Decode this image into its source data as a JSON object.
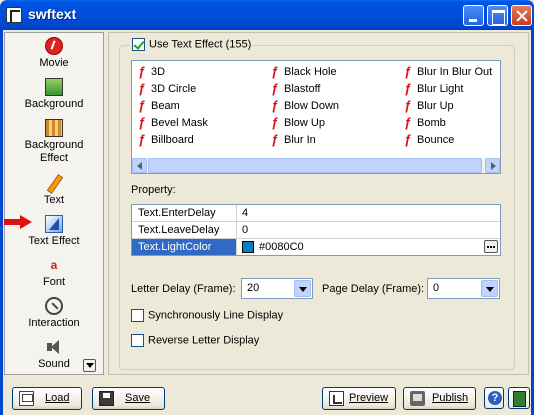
{
  "window": {
    "title": "swftext"
  },
  "sidebar": {
    "items": [
      {
        "label": "Movie",
        "icon": "movie-icon"
      },
      {
        "label": "Background",
        "icon": "background-icon"
      },
      {
        "label": "Background Effect",
        "icon": "background-effect-icon"
      },
      {
        "label": "Text",
        "icon": "text-pencil-icon"
      },
      {
        "label": "Text Effect",
        "icon": "text-effect-icon"
      },
      {
        "label": "Font",
        "icon": "font-icon"
      },
      {
        "label": "Interaction",
        "icon": "interaction-icon"
      },
      {
        "label": "Sound",
        "icon": "sound-icon"
      }
    ],
    "selected": "Text Effect"
  },
  "main": {
    "use_text_effect_label": "Use Text Effect (155)",
    "use_text_effect_checked": true,
    "effects": [
      {
        "name": "3D"
      },
      {
        "name": "Black Hole"
      },
      {
        "name": "Blur In Blur Out"
      },
      {
        "name": "3D Circle"
      },
      {
        "name": "Blastoff"
      },
      {
        "name": "Blur Light"
      },
      {
        "name": "Beam",
        "selected": true
      },
      {
        "name": "Blow Down"
      },
      {
        "name": "Blur Up"
      },
      {
        "name": "Bevel Mask"
      },
      {
        "name": "Blow Up"
      },
      {
        "name": "Bomb"
      },
      {
        "name": "Billboard"
      },
      {
        "name": "Blur In"
      },
      {
        "name": "Bounce"
      }
    ],
    "property_label": "Property:",
    "properties": [
      {
        "name": "Text.EnterDelay",
        "value": "4"
      },
      {
        "name": "Text.LeaveDelay",
        "value": "0"
      },
      {
        "name": "Text.LightColor",
        "value": "#0080C0",
        "swatch": "#0080C0",
        "selected": true
      }
    ],
    "letter_delay": {
      "label": "Letter Delay (Frame):",
      "value": "20"
    },
    "page_delay": {
      "label": "Page Delay (Frame):",
      "value": "0"
    },
    "sync_line_display": {
      "label": "Synchronously Line Display",
      "checked": false
    },
    "reverse_letter_display": {
      "label": "Reverse Letter Display",
      "checked": false
    }
  },
  "footer": {
    "load_label": "Load",
    "save_label": "Save",
    "preview_label": "Preview",
    "publish_label": "Publish"
  },
  "colors": {
    "titlebar": "#0050de",
    "selection": "#316ac5",
    "effect_icon": "#e01010"
  }
}
